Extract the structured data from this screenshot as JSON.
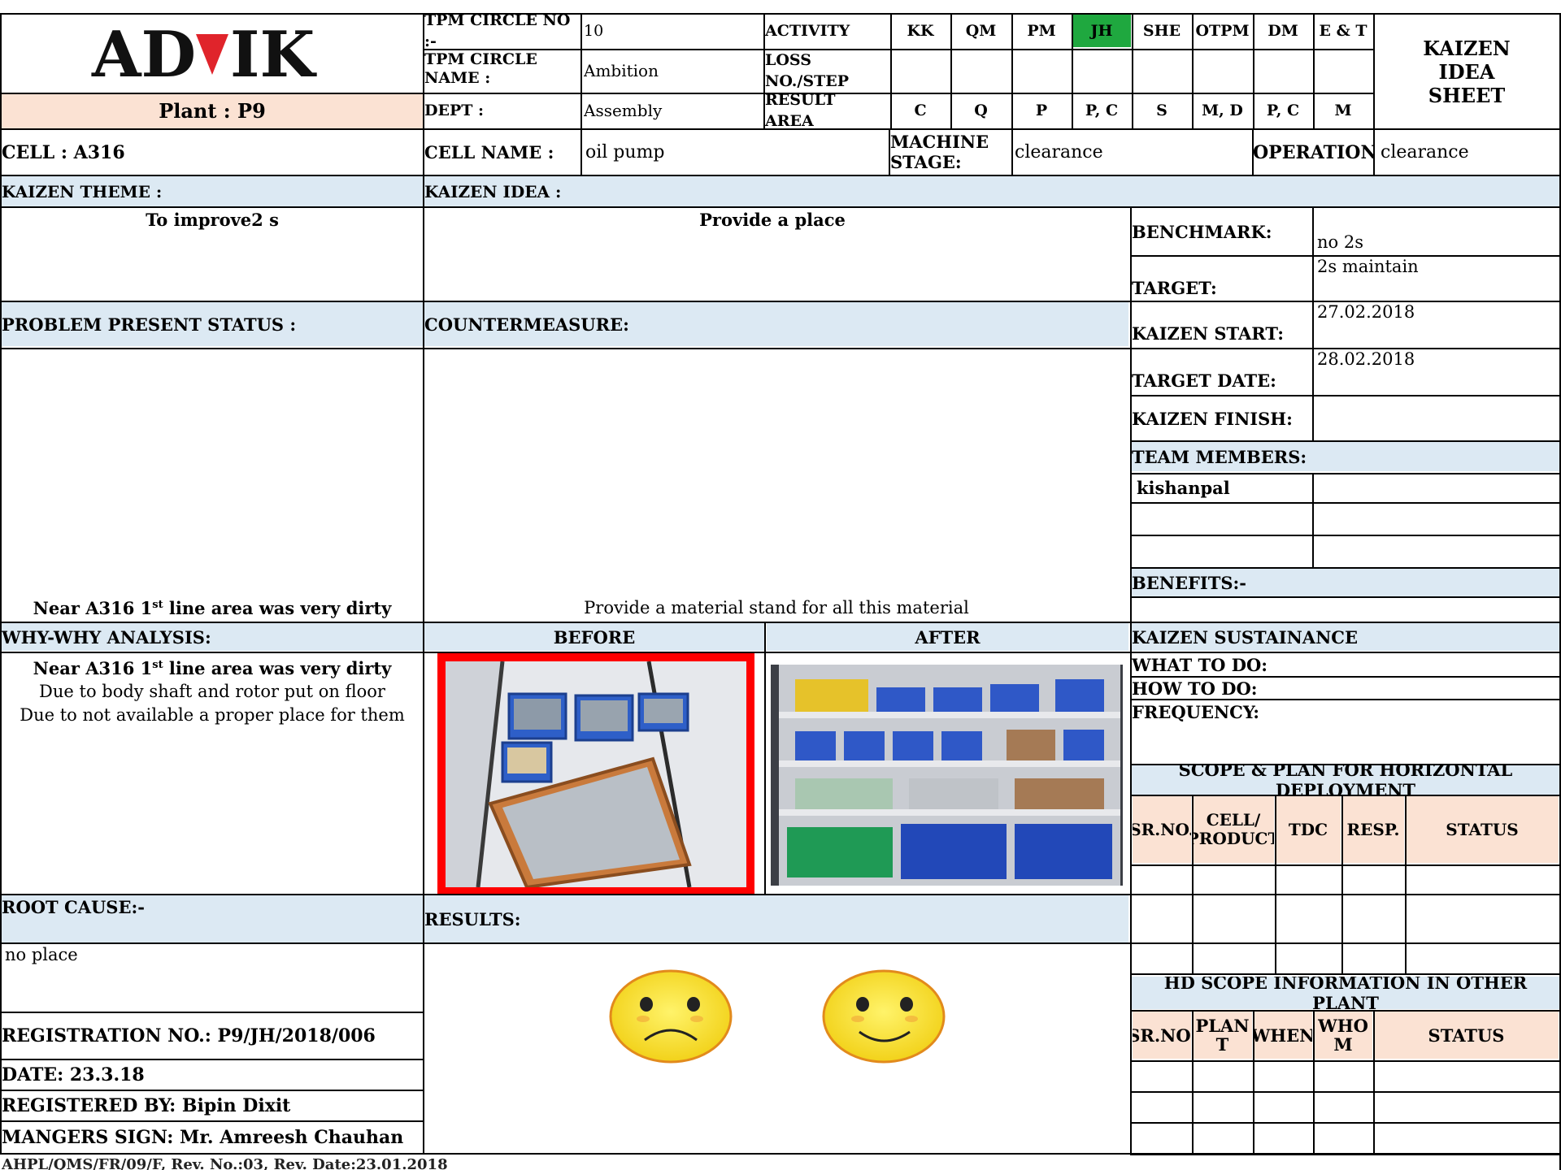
{
  "header": {
    "logo_text": "ADVIK",
    "plant": "Plant : P9",
    "tpm_circle_no_label": "TPM CIRCLE NO :-",
    "tpm_circle_no": "10",
    "tpm_circle_name_label": "TPM CIRCLE NAME :",
    "tpm_circle_name": "Ambition",
    "dept_label": "DEPT :",
    "dept": "Assembly",
    "activity_label": "ACTIVITY",
    "loss_label": "LOSS NO./STEP",
    "result_area_label": "RESULT AREA",
    "activities": [
      "KK",
      "QM",
      "PM",
      "JH",
      "SHE",
      "OTPM",
      "DM",
      "E & T"
    ],
    "active_activity": "JH",
    "result_areas": [
      "C",
      "Q",
      "P",
      "P, C",
      "S",
      "M, D",
      "P, C",
      "M"
    ],
    "sheet_title": "KAIZEN IDEA SHEET",
    "accent_green": "#1fa83f"
  },
  "cell_row": {
    "cell": "CELL : A316",
    "cell_name_label": "CELL NAME :",
    "cell_name": "oil pump",
    "machine_stage_label": "MACHINE STAGE:",
    "machine_stage": "clearance",
    "operation_label": "OPERATION:",
    "operation": "clearance"
  },
  "theme": {
    "label": "KAIZEN THEME :",
    "value": "To improve2 s",
    "idea_label": "KAIZEN IDEA :",
    "idea_value": "Provide a place"
  },
  "side": {
    "benchmark_label": "BENCHMARK:",
    "benchmark": "no 2s",
    "target_label": "TARGET:",
    "target": "2s maintain",
    "start_label": "KAIZEN START:",
    "start": "27.02.2018",
    "target_date_label": "TARGET DATE:",
    "target_date": "28.02.2018",
    "finish_label": "KAIZEN FINISH:",
    "finish": "",
    "team_label": "TEAM MEMBERS:",
    "team": [
      "kishanpal"
    ],
    "benefits_label": "BENEFITS:-",
    "sustain_label": "KAIZEN SUSTAINANCE",
    "what_label": "WHAT TO DO:",
    "how_label": "HOW TO DO:",
    "freq_label": "FREQUENCY:",
    "scope_label": "SCOPE & PLAN FOR HORIZONTAL DEPLOYMENT",
    "scope_cols": [
      "SR.NO.",
      "CELL/ PRODUCT",
      "TDC",
      "RESP.",
      "STATUS"
    ],
    "hd_label": "HD SCOPE INFORMATION IN OTHER PLANT",
    "hd_cols": [
      "SR.NO.",
      "PLAN T",
      "WHEN",
      "WHO M",
      "STATUS"
    ]
  },
  "problem": {
    "label": "PROBLEM PRESENT STATUS :",
    "text_pre": "Near A316 1",
    "text_sup": "st",
    "text_post": " line area was very dirty"
  },
  "counter": {
    "label": "COUNTERMEASURE:",
    "text": "Provide a material stand for all this material"
  },
  "why": {
    "label": "WHY-WHY ANALYSIS:",
    "line1_pre": "Near A316 1",
    "line1_sup": "st",
    "line1_post": " line area was very dirty",
    "line2": "Due to body shaft and rotor put on floor",
    "line3": "Due to not available  a proper place for them"
  },
  "before_label": "BEFORE",
  "after_label": "AFTER",
  "root": {
    "label": "ROOT CAUSE:-",
    "value": "no place"
  },
  "results_label": "RESULTS:",
  "footer": {
    "registration": "REGISTRATION NO.: P9/JH/2018/006",
    "date": "DATE: 23.3.18",
    "registered_by": "REGISTERED BY: Bipin Dixit",
    "managers_sign": "MANGERS SIGN: Mr. Amreesh Chauhan",
    "doc_ref": "AHPL/QMS/FR/09/F, Rev. No.:03, Rev. Date:23.01.2018"
  }
}
